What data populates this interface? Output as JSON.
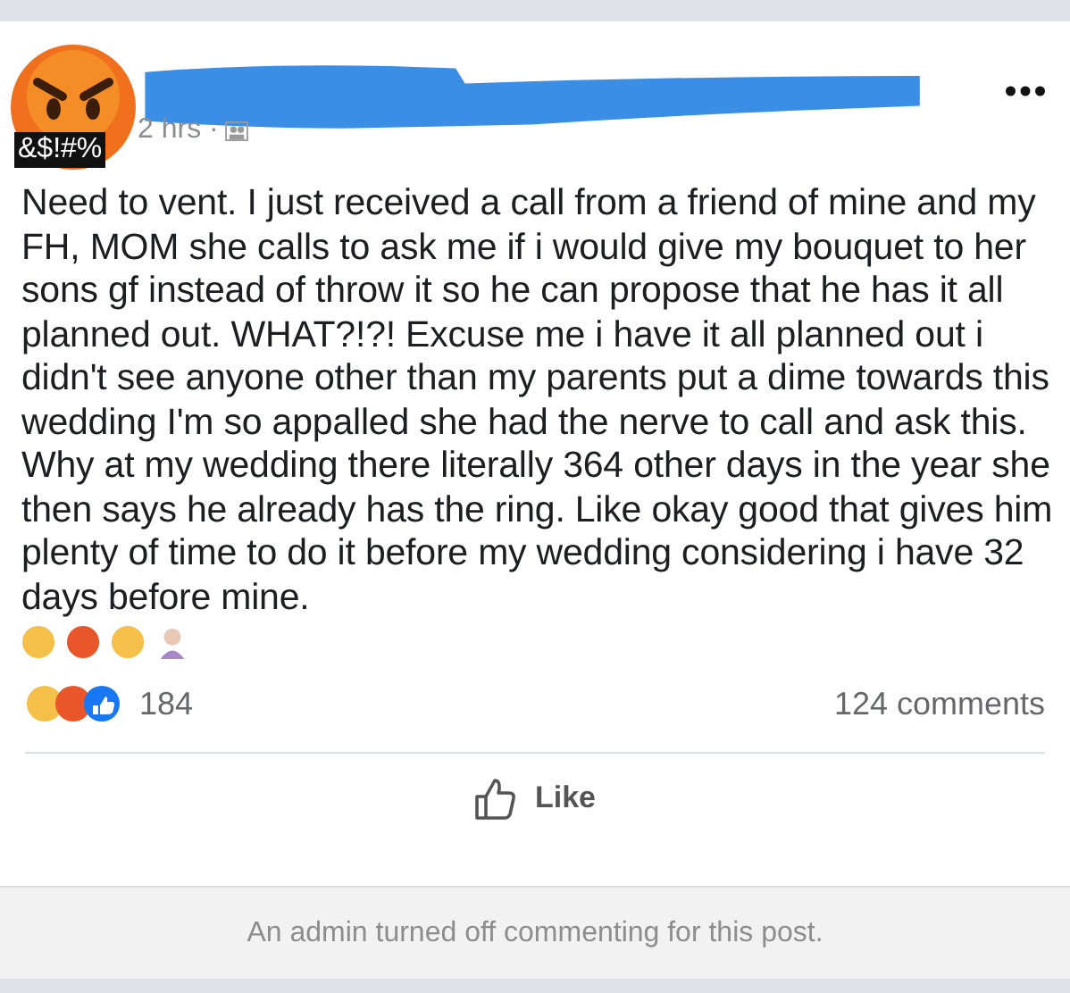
{
  "post": {
    "avatar_caption": "&$!#%",
    "time": "2 hrs ·",
    "body": "Need to vent. I just received a call from a friend of mine and my FH, MOM she calls to ask me if i would give my bouquet to her sons gf instead of throw it so he can propose that he has it all planned out. WHAT?!?! Excuse me i have it all planned out i didn't see anyone other than my parents put a dime towards this wedding I'm so appalled she had the nerve to call and ask this. Why at my wedding there literally 364 other days in the year she then says he already has the ring. Like okay good that gives him plenty of time to do it before my wedding considering i have 32 days before mine.",
    "reaction_count": "184",
    "comments": "124 comments",
    "like_button": "Like",
    "notice": "An admin turned off commenting for this post."
  }
}
